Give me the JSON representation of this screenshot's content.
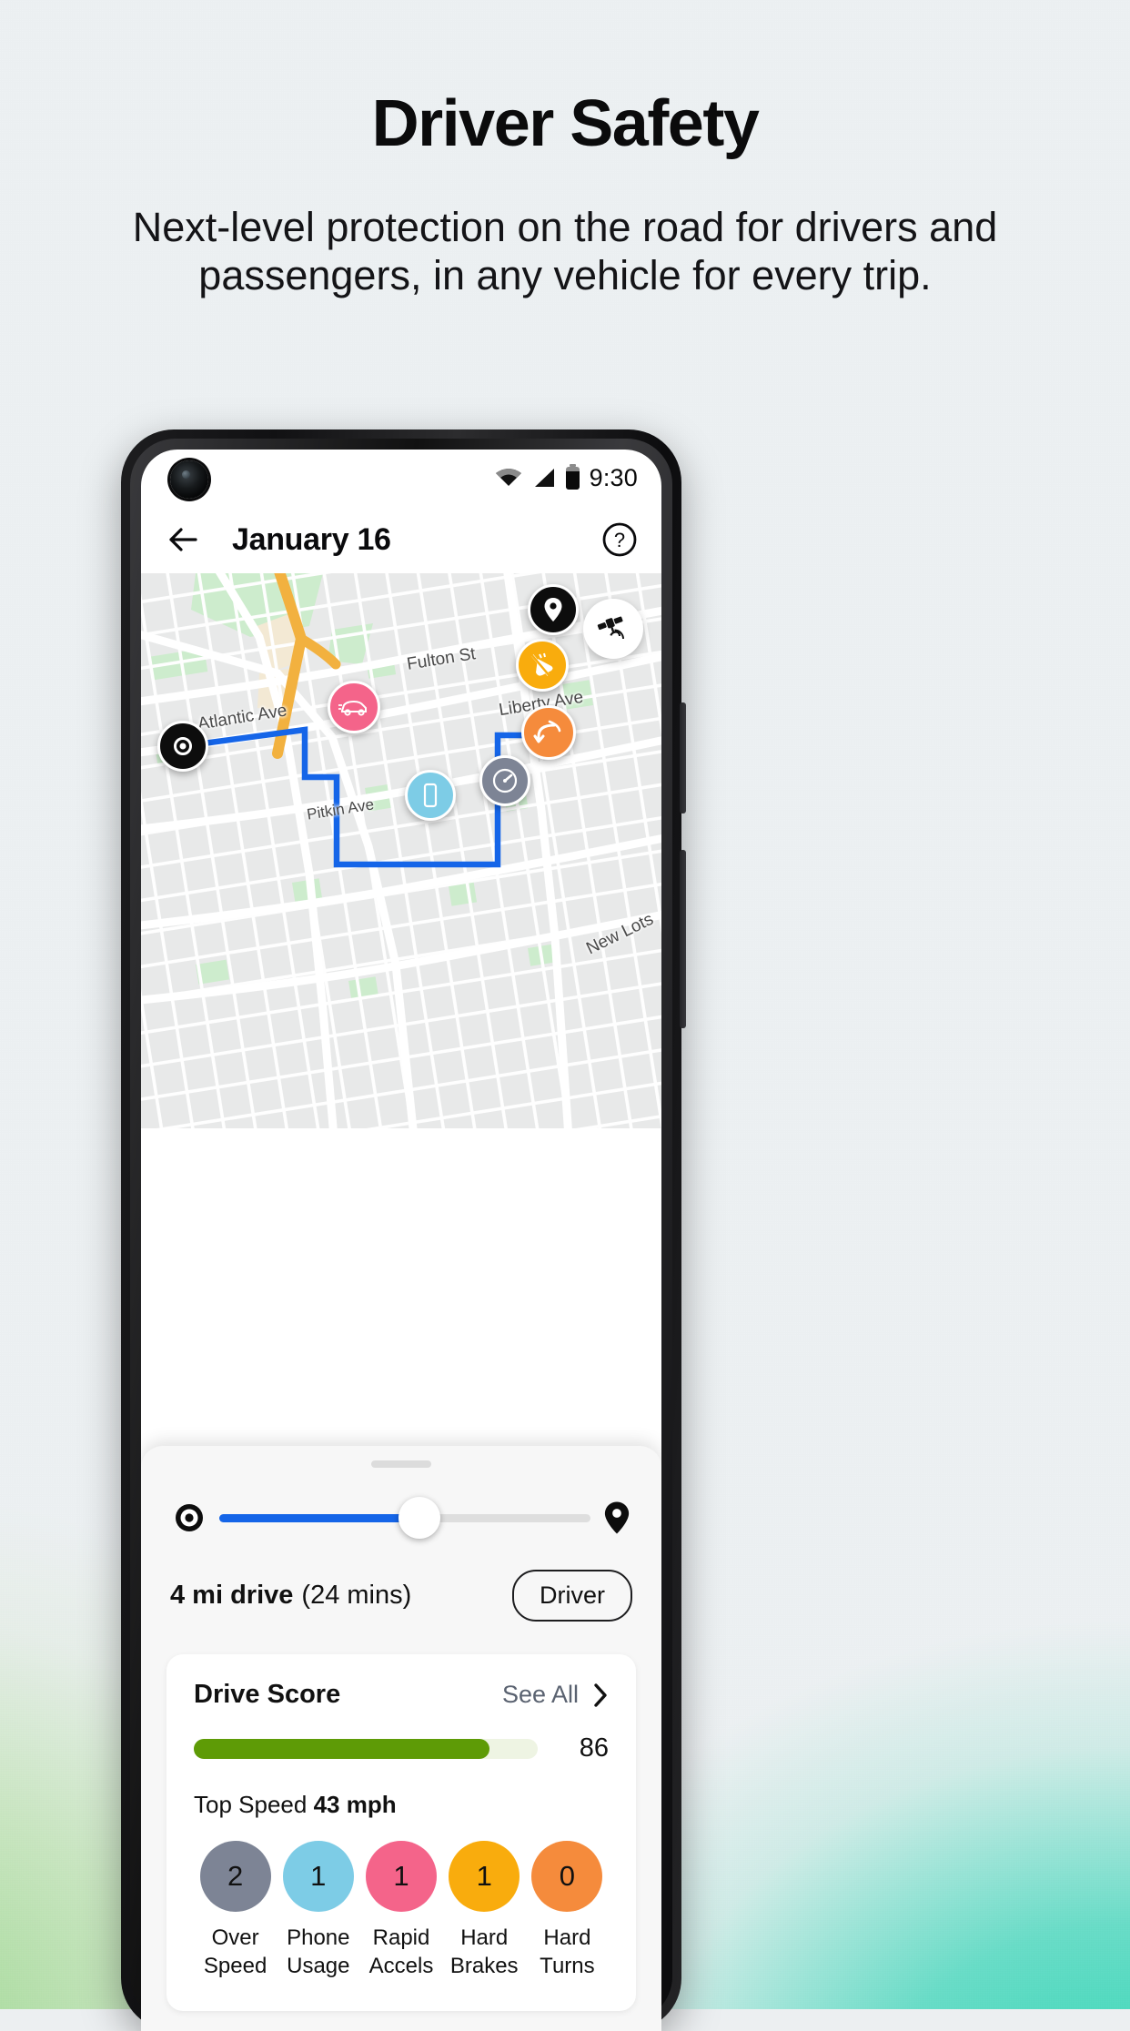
{
  "page": {
    "headline": "Driver Safety",
    "subheadline": "Next-level protection on the road for drivers and passengers, in any vehicle for every trip.",
    "bg_top_color": "#edf1f3",
    "bg_accent_teal": "#26d6b2",
    "bg_accent_green": "#96d687"
  },
  "phone": {
    "statusbar": {
      "time": "9:30",
      "icons": [
        "wifi-icon",
        "cell-signal-icon",
        "battery-icon"
      ]
    },
    "appbar": {
      "back_icon": "back-arrow-icon",
      "title": "January 16",
      "help_icon": "help-circle-icon"
    }
  },
  "map": {
    "satellite_button_icon": "satellite-icon",
    "street_labels": [
      "Fulton St",
      "Atlantic Ave",
      "Liberty Ave",
      "Pitkin Ave",
      "New Lots"
    ],
    "route_color": "#1565e8",
    "start_marker": "trip-start-icon",
    "end_marker": "trip-destination-pin-icon",
    "event_markers": [
      {
        "name": "rapid-accel-marker",
        "icon": "car-icon",
        "color": "#f4648a"
      },
      {
        "name": "hard-brake-marker",
        "icon": "hard-brake-icon",
        "color": "#f9ac0d"
      },
      {
        "name": "hard-turn-marker",
        "icon": "hard-turn-icon",
        "color": "#f58b3c"
      },
      {
        "name": "over-speed-marker",
        "icon": "speedometer-icon",
        "color": "#7d8495"
      },
      {
        "name": "phone-usage-marker",
        "icon": "phone-icon",
        "color": "#7dcce6"
      }
    ]
  },
  "sheet": {
    "slider": {
      "start_icon": "trip-start-icon",
      "end_icon": "destination-pin-icon",
      "progress_percent": 54
    },
    "trip": {
      "distance": "4 mi drive",
      "duration": "(24 mins)",
      "role_badge": "Driver"
    },
    "drive_score": {
      "title": "Drive Score",
      "see_all": "See All",
      "chevron_icon": "chevron-right-icon",
      "score": "86",
      "score_percent": 86,
      "bar_color": "#5e9b06",
      "top_speed_label": "Top Speed",
      "top_speed_value": "43 mph",
      "metrics": [
        {
          "value": "2",
          "label_line1": "Over",
          "label_line2": "Speed",
          "color": "#7d8495"
        },
        {
          "value": "1",
          "label_line1": "Phone",
          "label_line2": "Usage",
          "color": "#7dcce6"
        },
        {
          "value": "1",
          "label_line1": "Rapid",
          "label_line2": "Accels",
          "color": "#f4648a"
        },
        {
          "value": "1",
          "label_line1": "Hard",
          "label_line2": "Brakes",
          "color": "#f9ac0d"
        },
        {
          "value": "0",
          "label_line1": "Hard",
          "label_line2": "Turns",
          "color": "#f58b3c"
        }
      ]
    }
  }
}
